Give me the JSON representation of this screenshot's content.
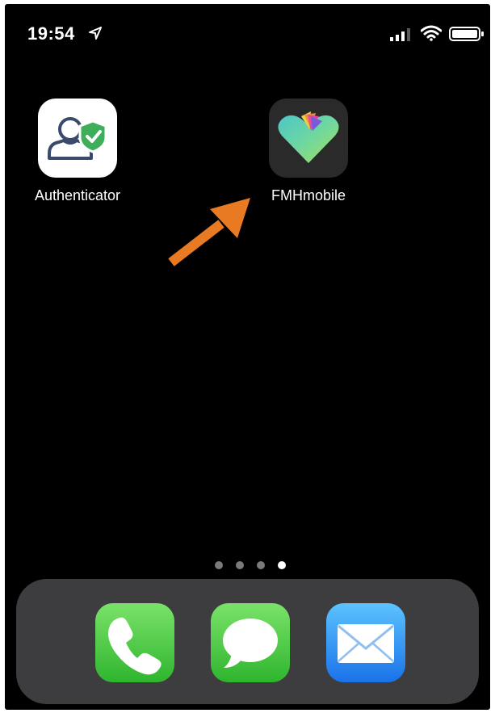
{
  "status_bar": {
    "time": "19:54",
    "icons": [
      "location-arrow-icon",
      "cellular-signal-icon",
      "wifi-icon",
      "battery-icon"
    ]
  },
  "home_screen": {
    "apps": [
      {
        "label": "Authenticator",
        "icon": "authenticator-icon",
        "accent": "#3fae5b"
      },
      {
        "label": "FMHmobile",
        "icon": "fmhmobile-heart-icon",
        "accent": "#6fd7b8"
      }
    ],
    "annotation": {
      "icon": "orange-arrow-icon",
      "color": "#e87a24"
    },
    "page_dots": {
      "count": 4,
      "active_index": 3
    }
  },
  "dock": {
    "apps": [
      {
        "icon": "phone-icon"
      },
      {
        "icon": "messages-icon"
      },
      {
        "icon": "mail-icon"
      }
    ]
  }
}
